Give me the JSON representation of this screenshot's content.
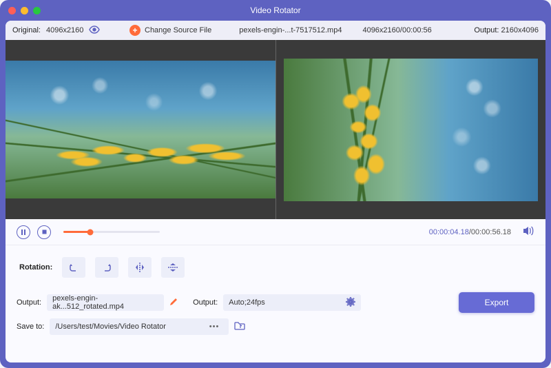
{
  "title": "Video Rotator",
  "infobar": {
    "original_label": "Original:",
    "original_res": "4096x2160",
    "change_label": "Change Source File",
    "filename": "pexels-engin-...t-7517512.mp4",
    "src_info": "4096x2160/00:00:56",
    "output_label": "Output:",
    "output_res": "2160x4096"
  },
  "playback": {
    "current": "00:00:04.18",
    "total": "/00:00:56.18"
  },
  "rotation": {
    "label": "Rotation:"
  },
  "output": {
    "label1": "Output:",
    "filename": "pexels-engin-ak...512_rotated.mp4",
    "label2": "Output:",
    "preset": "Auto;24fps",
    "export": "Export"
  },
  "save": {
    "label": "Save to:",
    "path": "/Users/test/Movies/Video Rotator",
    "dots": "•••"
  }
}
